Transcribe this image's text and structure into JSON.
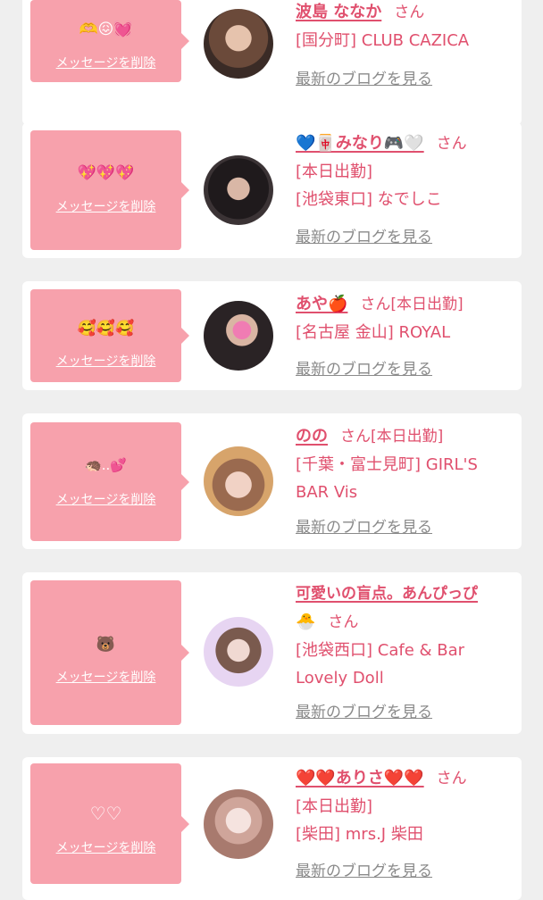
{
  "delete_label": "メッセージを削除",
  "blog_label": "最新のブログを見る",
  "san": "さん",
  "cards": [
    {
      "emoji": "🫶😖💓",
      "name": "波島 ななか",
      "lines": [
        "[国分町] CLUB CAZICA"
      ]
    },
    {
      "emoji": "💖💖💖",
      "name": "💙🀄みなり🎮🤍",
      "lines": [
        "[本日出勤]",
        "[池袋東口] なでしこ"
      ]
    },
    {
      "emoji": "🥰🥰🥰",
      "name": "あや🍎",
      "san_suffix": "[本日出勤]",
      "lines": [
        "[名古屋 金山] ROYAL"
      ]
    },
    {
      "emoji": "🦔..💕",
      "name": "のの",
      "san_suffix": "[本日出勤]",
      "lines": [
        "[千葉・富士見町] GIRL'S",
        "BAR Vis"
      ]
    },
    {
      "emoji": "🐻",
      "name": "可愛いの盲点。あんぴっぴ",
      "name_cont": "🐣",
      "lines": [
        "[池袋西口] Cafe & Bar",
        "Lovely Doll"
      ]
    },
    {
      "emoji": "♡♡",
      "name": "❤️❤️ありさ❤️❤️",
      "lines": [
        "[本日出勤]",
        "[柴田] mrs.J 柴田"
      ]
    }
  ],
  "colors": {
    "accent": "#e0506e",
    "bubble": "#f7a1ac",
    "background": "#efefef"
  }
}
